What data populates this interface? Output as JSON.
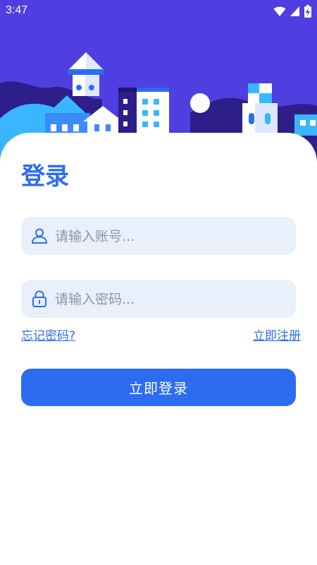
{
  "status_bar": {
    "time": "3:47",
    "icons": [
      "wifi-icon",
      "signal-icon",
      "battery-charging-icon"
    ]
  },
  "colors": {
    "hero_background": "#4f3ee0",
    "accent": "#2c6cf0",
    "field_background": "#e9f0fb",
    "placeholder": "#8d96a4"
  },
  "login": {
    "title": "登录",
    "username": {
      "value": "",
      "placeholder": "请输入账号...",
      "icon": "user-icon"
    },
    "password": {
      "value": "",
      "placeholder": "请输入密码...",
      "icon": "lock-icon"
    },
    "forgot_password_label": "忘记密码?",
    "register_label": "立即注册",
    "submit_label": "立即登录"
  }
}
